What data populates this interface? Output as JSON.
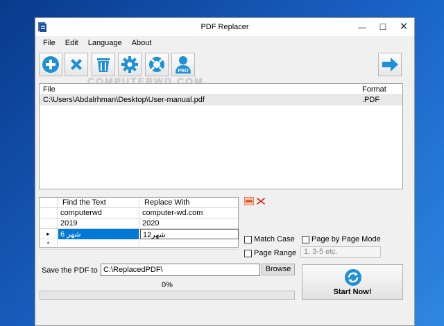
{
  "window": {
    "title": "PDF Replacer",
    "controls": {
      "minimize": "—",
      "maximize": "☐",
      "close": "✕"
    }
  },
  "menu": {
    "items": [
      {
        "label": "File"
      },
      {
        "label": "Edit"
      },
      {
        "label": "Language"
      },
      {
        "label": "About"
      }
    ]
  },
  "toolbar": {
    "buttons": [
      {
        "icon": "add-icon"
      },
      {
        "icon": "remove-icon"
      },
      {
        "icon": "trash-icon"
      },
      {
        "icon": "gear-icon"
      },
      {
        "icon": "help-lifebuoy-icon"
      },
      {
        "icon": "pro-user-icon",
        "badge": "PRO"
      }
    ],
    "next_icon": "arrow-right-icon"
  },
  "watermark": "COMPUTERWD.COM",
  "file_list": {
    "columns": {
      "file": "File",
      "format": "Format"
    },
    "rows": [
      {
        "file": "C:\\Users\\Abdalrhman\\Desktop\\User-manual.pdf",
        "format": ".PDF"
      }
    ]
  },
  "replace_table": {
    "columns": {
      "find": "Find the Text",
      "replace": "Replace With"
    },
    "rows": [
      {
        "indicator": "",
        "find": "computerwd",
        "replace": "computer-wd.com"
      },
      {
        "indicator": "",
        "find": "2019",
        "replace": "2020"
      },
      {
        "indicator": "▸",
        "find": "6 شهر",
        "replace": "12شهر"
      },
      {
        "indicator": "*",
        "find": "",
        "replace": ""
      }
    ]
  },
  "options": {
    "match_case": "Match Case",
    "page_by_page": "Page by Page Mode",
    "page_range": "Page Range",
    "page_range_placeholder": "1, 3-5 etc."
  },
  "save": {
    "label": "Save the PDF to",
    "path": "C:\\ReplacedPDF\\",
    "browse": "Browse"
  },
  "progress": {
    "text": "0%",
    "value": 0
  },
  "start": {
    "label": "Start Now!"
  },
  "colors": {
    "accent_blue": "#1e90d8",
    "selection": "#0078d7",
    "minus_button": "#e04a16",
    "delete_button": "#d82a1a"
  }
}
